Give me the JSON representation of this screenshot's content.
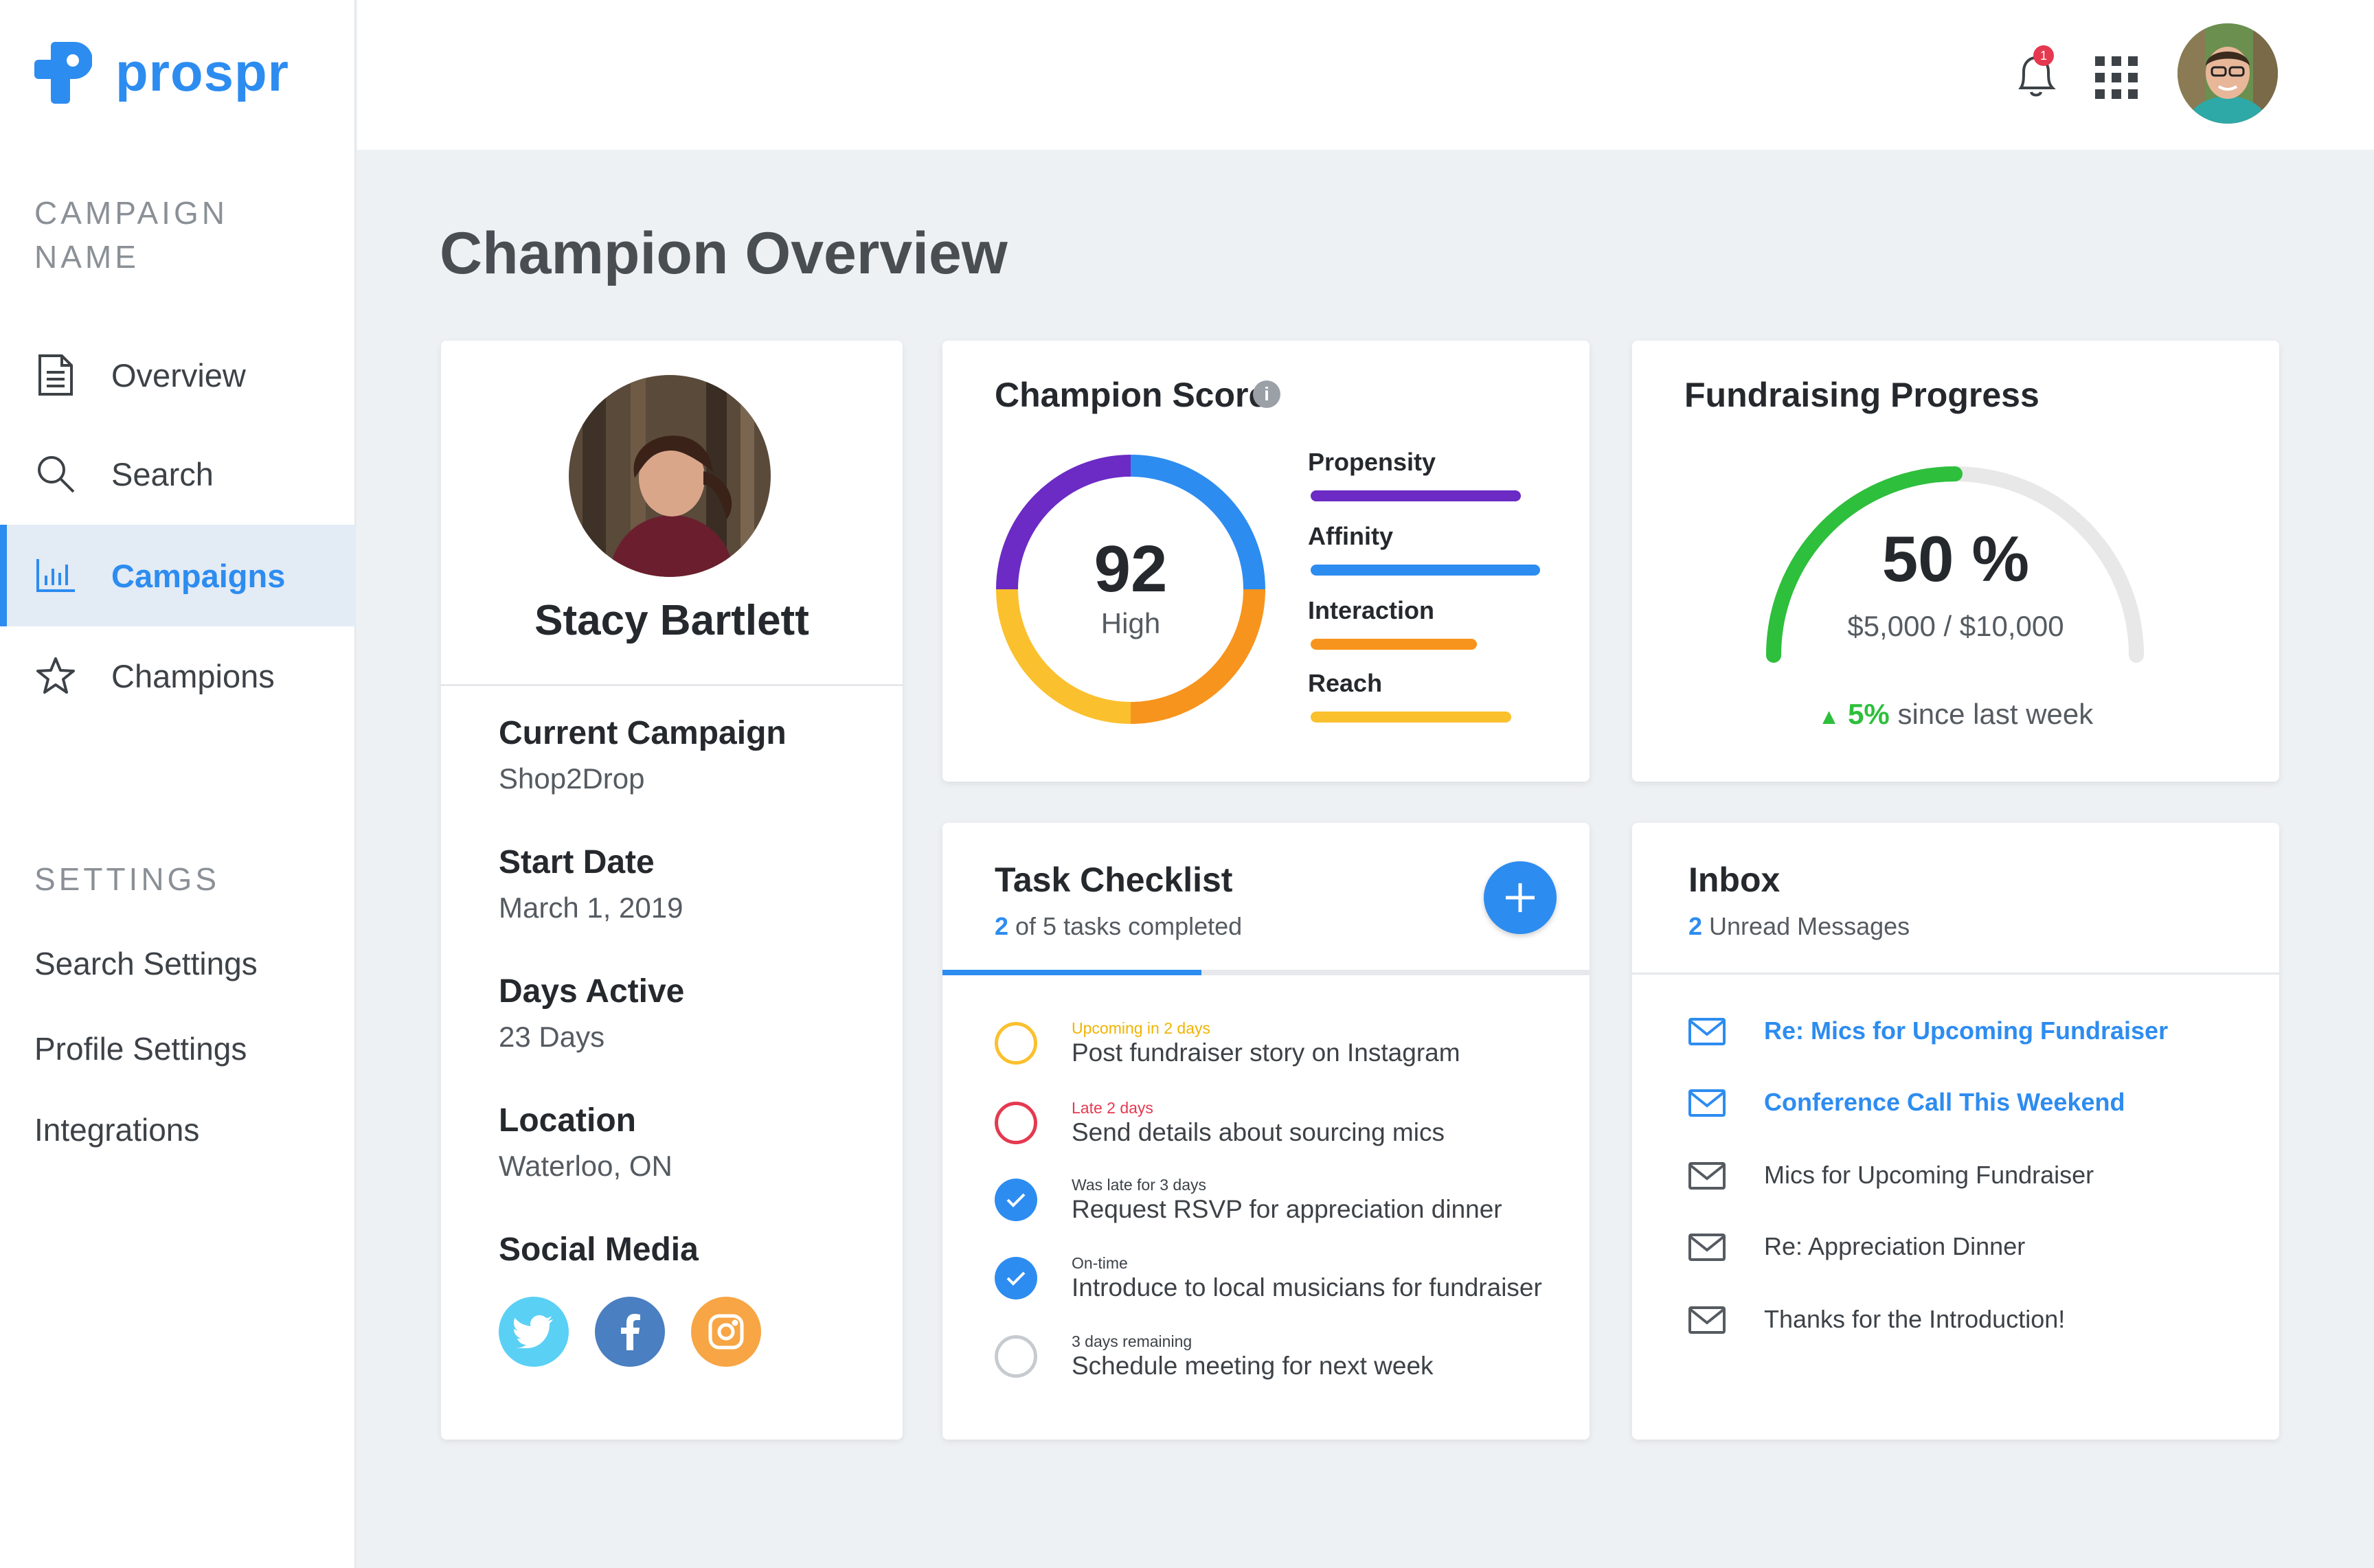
{
  "app": {
    "name": "prospr",
    "brand_color": "#2d8cf0"
  },
  "sidebar": {
    "campaign_label": "CAMPAIGN NAME",
    "nav": [
      {
        "label": "Overview",
        "icon": "document-icon"
      },
      {
        "label": "Search",
        "icon": "search-icon"
      },
      {
        "label": "Campaigns",
        "icon": "bar-chart-icon",
        "active": true
      },
      {
        "label": "Champions",
        "icon": "star-icon"
      }
    ],
    "settings_label": "SETTINGS",
    "settings": [
      "Search Settings",
      "Profile Settings",
      "Integrations"
    ]
  },
  "topbar": {
    "notification_count": "1"
  },
  "page": {
    "title": "Champion Overview"
  },
  "profile": {
    "name": "Stacy Bartlett",
    "fields": [
      {
        "label": "Current Campaign",
        "value": "Shop2Drop"
      },
      {
        "label": "Start Date",
        "value": "March 1, 2019"
      },
      {
        "label": "Days Active",
        "value": "23 Days"
      },
      {
        "label": "Location",
        "value": "Waterloo, ON"
      }
    ],
    "social_label": "Social Media",
    "social": [
      {
        "name": "twitter",
        "color": "#5bd0f5"
      },
      {
        "name": "facebook",
        "color": "#4a7fc1"
      },
      {
        "name": "instagram",
        "color": "#f7a545"
      }
    ]
  },
  "score": {
    "title": "Champion Score",
    "value": "92",
    "level": "High",
    "legend": [
      {
        "label": "Propensity",
        "color": "#6b2bc4"
      },
      {
        "label": "Affinity",
        "color": "#2d8cf0"
      },
      {
        "label": "Interaction",
        "color": "#f7941d"
      },
      {
        "label": "Reach",
        "color": "#fbc02d"
      }
    ]
  },
  "fundraising": {
    "title": "Fundraising Progress",
    "percent_text": "50 %",
    "progress": 0.5,
    "amount": "$5,000 / $10,000",
    "change": "5%",
    "change_suffix": " since last week",
    "color": "#2ebf3c"
  },
  "tasks": {
    "title": "Task Checklist",
    "completed_count": "2",
    "completed_suffix": " of 5 tasks completed",
    "progress": 0.4,
    "items": [
      {
        "status": "Upcoming in 2 days",
        "status_color": "#f0b400",
        "text": "Post fundraiser story on Instagram",
        "state": "upcoming"
      },
      {
        "status": "Late 2 days",
        "status_color": "#e53950",
        "text": "Send details about sourcing mics",
        "state": "late"
      },
      {
        "status": "Was late for 3 days",
        "status_color": "#3d4247",
        "text": "Request RSVP for appreciation dinner",
        "state": "done"
      },
      {
        "status": "On-time",
        "status_color": "#3d4247",
        "text": "Introduce to local musicians for fundraiser",
        "state": "done"
      },
      {
        "status": "3 days remaining",
        "status_color": "#3d4247",
        "text": "Schedule meeting for next week",
        "state": "open"
      }
    ]
  },
  "inbox": {
    "title": "Inbox",
    "unread_count": "2",
    "unread_suffix": " Unread Messages",
    "messages": [
      {
        "subject": "Re: Mics for Upcoming Fundraiser",
        "unread": true
      },
      {
        "subject": "Conference Call This Weekend",
        "unread": true
      },
      {
        "subject": "Mics for Upcoming Fundraiser",
        "unread": false
      },
      {
        "subject": "Re: Appreciation Dinner",
        "unread": false
      },
      {
        "subject": "Thanks for the Introduction!",
        "unread": false
      }
    ]
  }
}
